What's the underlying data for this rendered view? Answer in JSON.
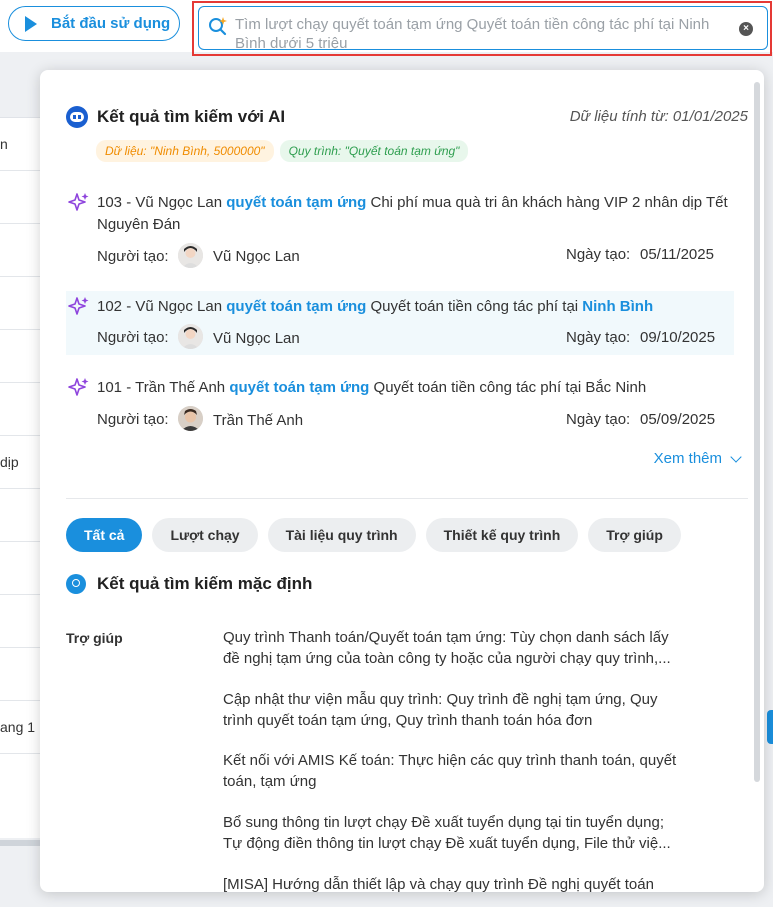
{
  "toolbar": {
    "start_label": "Bắt đầu sử dụng"
  },
  "search": {
    "query": "Tìm lượt chạy quyết toán tạm ứng Quyết toán tiền công tác phí tại Ninh Bình dưới 5 triệu"
  },
  "background_rows": [
    "n",
    "",
    "",
    "",
    "",
    "",
    "dịp",
    "",
    "",
    "",
    "",
    "ang 1"
  ],
  "ai_section": {
    "title": "Kết quả tìm kiếm với AI",
    "date_note": "Dữ liệu tính từ: 01/01/2025",
    "chips": [
      "Dữ liệu: \"Ninh Bình, 5000000\"",
      "Quy trình: \"Quyết toán tạm ứng\""
    ],
    "creator_label": "Người tạo:",
    "date_label": "Ngày tạo:",
    "results": [
      {
        "prefix": "103 - Vũ Ngọc Lan ",
        "keyword": "quyết toán tạm ứng",
        "rest": " Chi phí mua quà tri ân khách hàng VIP 2 nhân dịp Tết Nguyên Đán",
        "location": "",
        "author": "Vũ Ngọc Lan",
        "date": "05/11/2025"
      },
      {
        "prefix": "102 - Vũ Ngọc Lan ",
        "keyword": "quyết toán tạm ứng",
        "rest": " Quyết toán tiền công tác phí tại ",
        "location": "Ninh Bình",
        "author": "Vũ Ngọc Lan",
        "date": "09/10/2025"
      },
      {
        "prefix": "101 - Trần Thế Anh ",
        "keyword": "quyết toán tạm ứng",
        "rest": " Quyết toán tiền công tác phí tại Bắc Ninh",
        "location": "",
        "author": "Trần Thế Anh",
        "date": "05/09/2025"
      }
    ],
    "see_more": "Xem thêm"
  },
  "tabs": [
    "Tất cả",
    "Lượt chạy",
    "Tài liệu quy trình",
    "Thiết kế quy trình",
    "Trợ giúp"
  ],
  "default_section": {
    "title": "Kết quả tìm kiếm mặc định",
    "help_label": "Trợ giúp",
    "items": [
      "Quy trình Thanh toán/Quyết toán tạm ứng: Tùy chọn danh sách lấy đề nghị tạm ứng của toàn công ty hoặc của người chạy quy trình,...",
      "Cập nhật thư viện mẫu quy trình: Quy trình đề nghị tạm ứng, Quy trình quyết toán tạm ứng, Quy trình thanh toán hóa đơn",
      "Kết nối với AMIS Kế toán: Thực hiện các quy trình thanh toán, quyết toán, tạm ứng",
      "Bổ sung thông tin lượt chạy Đề xuất tuyển dụng tại tin tuyển dụng; Tự động điền thông tin lượt chạy Đề xuất tuyển dụng, File thử việ...",
      "[MISA] Hướng dẫn thiết lập và chạy quy trình Đề nghị quyết toán"
    ]
  },
  "colors": {
    "accent": "#1a8fdd",
    "highlight": "#e53935"
  }
}
